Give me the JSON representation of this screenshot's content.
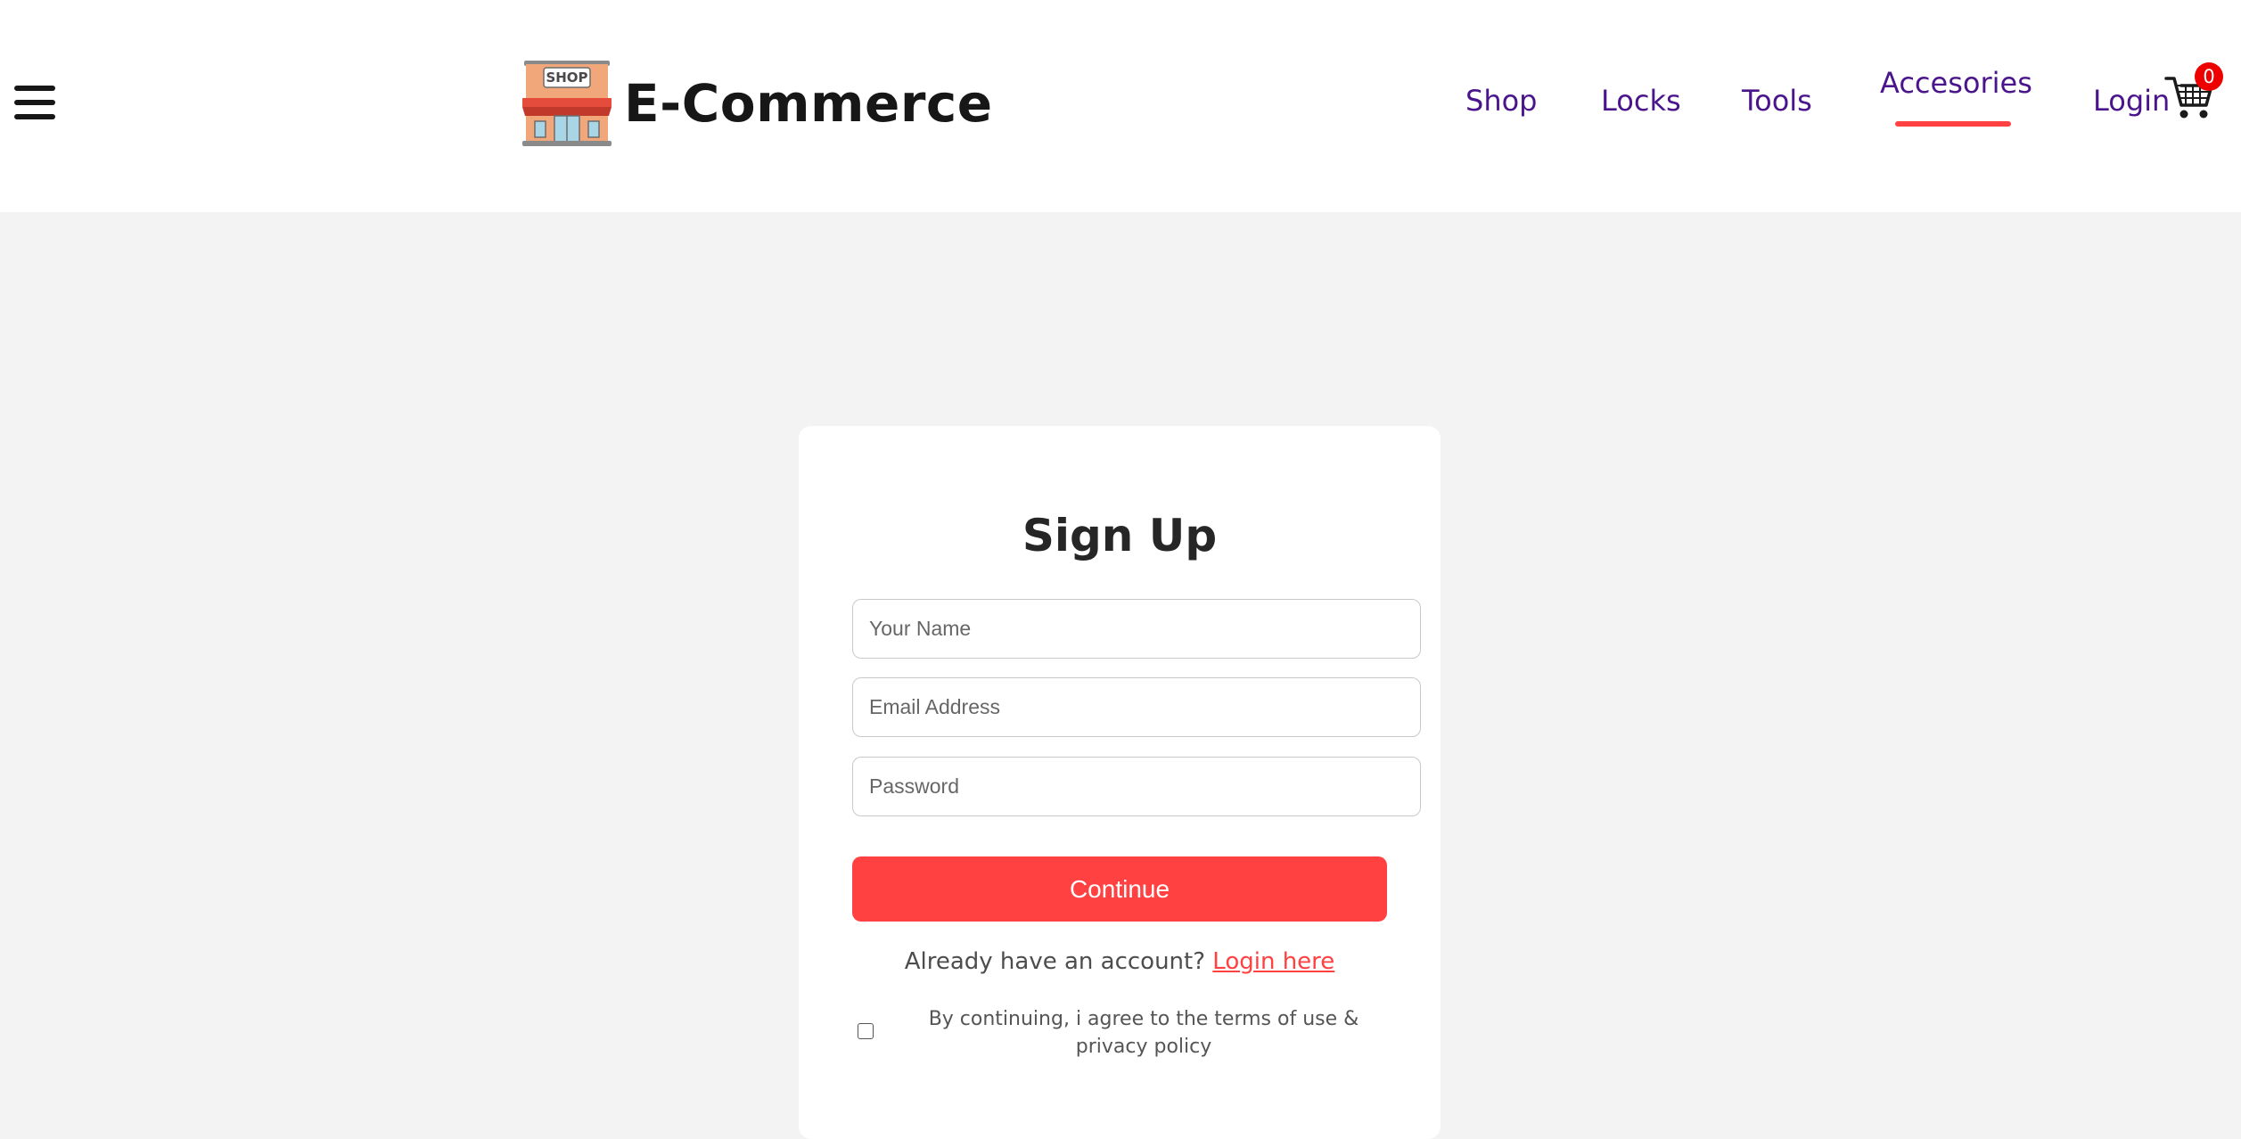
{
  "header": {
    "brand": "E-Commerce",
    "logo_icon": "shop-storefront-icon",
    "menu_icon": "hamburger-menu-icon",
    "nav": {
      "shop": "Shop",
      "locks": "Locks",
      "tools": "Tools",
      "accessories": "Accesories",
      "active": "Accesories"
    },
    "login_label": "Login",
    "cart_icon": "shopping-cart-icon",
    "cart_count": "0",
    "accent_color": "#ff4141",
    "nav_color": "#4a148c"
  },
  "signup": {
    "title": "Sign Up",
    "name_placeholder": "Your Name",
    "email_placeholder": "Email Address",
    "password_placeholder": "Password",
    "continue_label": "Continue",
    "have_account_text": "Already have an account?",
    "login_link": "Login here",
    "agree_text": "By continuing, i agree to the terms of use & privacy policy"
  }
}
